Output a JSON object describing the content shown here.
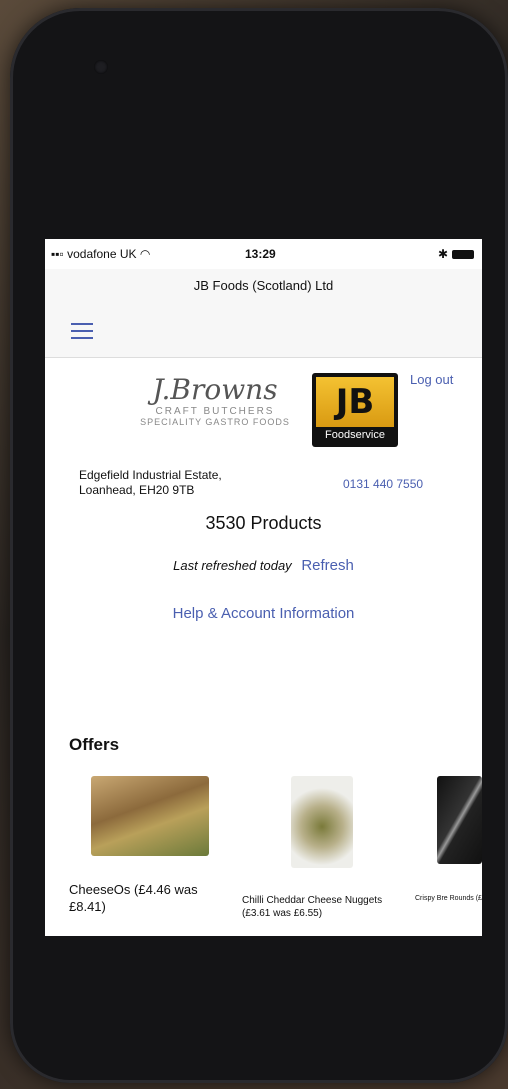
{
  "status_bar": {
    "carrier": "vodafone UK",
    "time": "13:29"
  },
  "nav": {
    "title": "JB Foods (Scotland) Ltd"
  },
  "branding": {
    "script_logo": "J.Browns",
    "line1": "CRAFT BUTCHERS",
    "line2": "SPECIALITY GASTRO FOODS",
    "badge_letters": "JB",
    "badge_label": "Foodservice"
  },
  "account": {
    "logout_label": "Log out"
  },
  "contact": {
    "address_line1": "Edgefield Industrial Estate,",
    "address_line2": "Loanhead, EH20 9TB",
    "phone": "0131 440 7550"
  },
  "catalog": {
    "products_label": "3530  Products",
    "last_refreshed_label": "Last refreshed",
    "last_refreshed_value": "today",
    "refresh_label": "Refresh",
    "help_label": "Help & Account Information"
  },
  "offers": {
    "title": "Offers",
    "items": [
      {
        "name": "CheeseOs (£4.46 was £8.41)"
      },
      {
        "name": "Chilli Cheddar Cheese Nuggets (£3.61 was £6.55)"
      },
      {
        "name": "Crispy Bre Rounds (£"
      }
    ]
  },
  "colors": {
    "link": "#4a5fb0",
    "badge_yellow": "#f4c232"
  }
}
